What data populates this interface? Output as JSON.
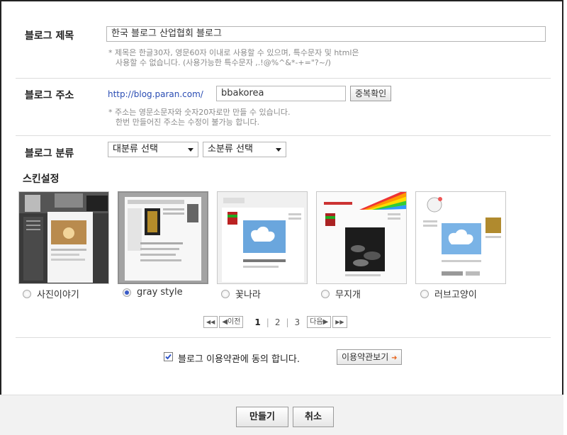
{
  "form": {
    "title_label": "블로그 제목",
    "title_value": "한국 블로그 산업협회 블로그",
    "title_note_1": "* 제목은 한글30자, 영문60자 이내로 사용할 수 있으며, 특수문자 및 html은",
    "title_note_2": "사용할 수 없습니다. (사용가능한 특수문자 ,.!@%^&*-+=\"?~/)",
    "address_label": "블로그 주소",
    "address_prefix": "http://blog.paran.com/",
    "address_value": "bbakorea",
    "duplicate_check_label": "중복확인",
    "address_note_1": "* 주소는 영문소문자와 숫자20자로만 만들 수 있습니다.",
    "address_note_2": "한번 만들어진 주소는 수정이 불가능 합니다.",
    "category_label": "블로그 분류",
    "category_major": "대분류 선택",
    "category_minor": "소분류 선택",
    "skin_label": "스킨설정"
  },
  "skins": [
    {
      "name": "사진이야기",
      "selected": false
    },
    {
      "name": "gray style",
      "selected": true
    },
    {
      "name": "꽃나라",
      "selected": false
    },
    {
      "name": "무지개",
      "selected": false
    },
    {
      "name": "러브고양이",
      "selected": false
    }
  ],
  "pager": {
    "first": "◀◀",
    "prev": "◀이전",
    "pages": [
      "1",
      "2",
      "3"
    ],
    "current": "1",
    "sep": "|",
    "next": "다음▶",
    "last": "▶▶"
  },
  "agreement": {
    "checked": true,
    "text": "블로그 이용약관에 동의 합니다.",
    "view_terms_label": "이용약관보기",
    "view_terms_arrow": "➜"
  },
  "actions": {
    "create_label": "만들기",
    "cancel_label": "취소"
  },
  "colors": {
    "link_blue": "#2a4cb3",
    "arrow_orange": "#e8631a",
    "check_blue": "#2f56c9"
  }
}
